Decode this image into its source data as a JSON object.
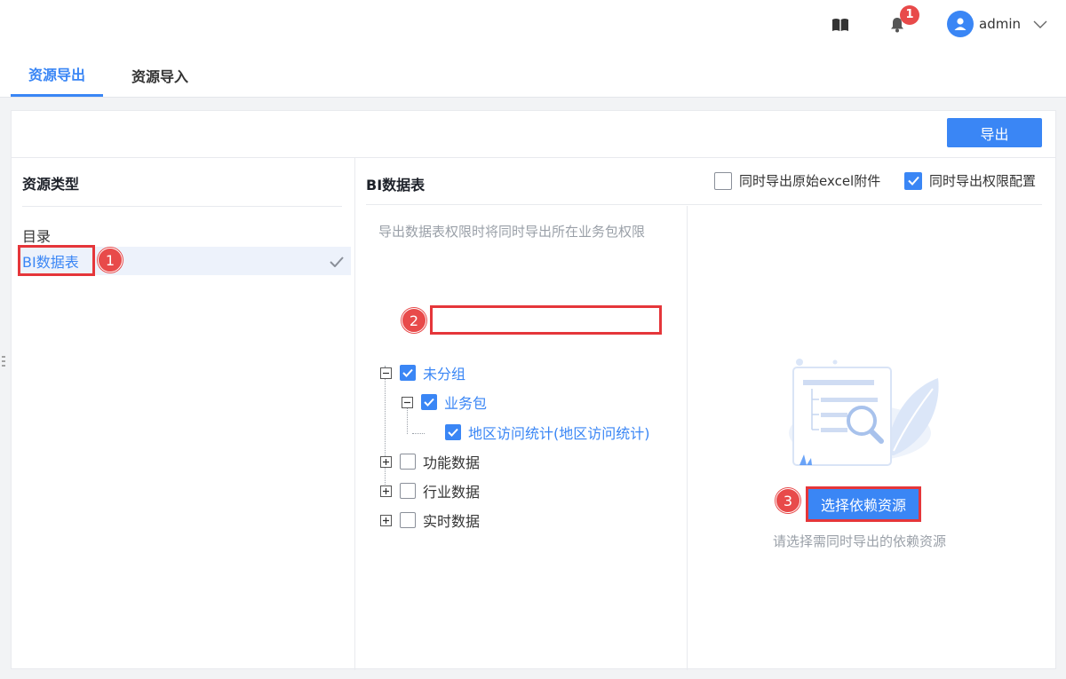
{
  "header": {
    "book_icon": "book-icon",
    "notifications": {
      "icon": "bell-icon",
      "count": "1"
    },
    "user": {
      "name": "admin"
    }
  },
  "tabs": [
    {
      "label": "资源导出",
      "active": true
    },
    {
      "label": "资源导入",
      "active": false
    }
  ],
  "toolbar": {
    "export_label": "导出"
  },
  "left_panel": {
    "title": "资源类型",
    "items": [
      {
        "label": "目录",
        "selected": false
      },
      {
        "label": "BI数据表",
        "selected": true
      }
    ]
  },
  "middle_panel": {
    "title": "BI数据表",
    "options": [
      {
        "label": "同时导出原始excel附件",
        "checked": false
      },
      {
        "label": "同时导出权限配置",
        "checked": true
      }
    ],
    "hint": "导出数据表权限时将同时导出所在业务包权限",
    "tree": [
      {
        "label": "未分组",
        "checked": true,
        "expanded": true
      },
      {
        "label": "业务包",
        "checked": true,
        "expanded": true
      },
      {
        "label": "地区访问统计(地区访问统计)",
        "checked": true
      },
      {
        "label": "功能数据",
        "checked": false,
        "expanded": false
      },
      {
        "label": "行业数据",
        "checked": false,
        "expanded": false
      },
      {
        "label": "实时数据",
        "checked": false,
        "expanded": false
      }
    ]
  },
  "right_panel": {
    "button_label": "选择依赖资源",
    "hint": "请选择需同时导出的依赖资源"
  },
  "annotations": [
    "1",
    "2",
    "3"
  ],
  "colors": {
    "accent": "#3a86f5",
    "annotation_red": "#e5363a",
    "badge_red": "#e84a4a"
  }
}
